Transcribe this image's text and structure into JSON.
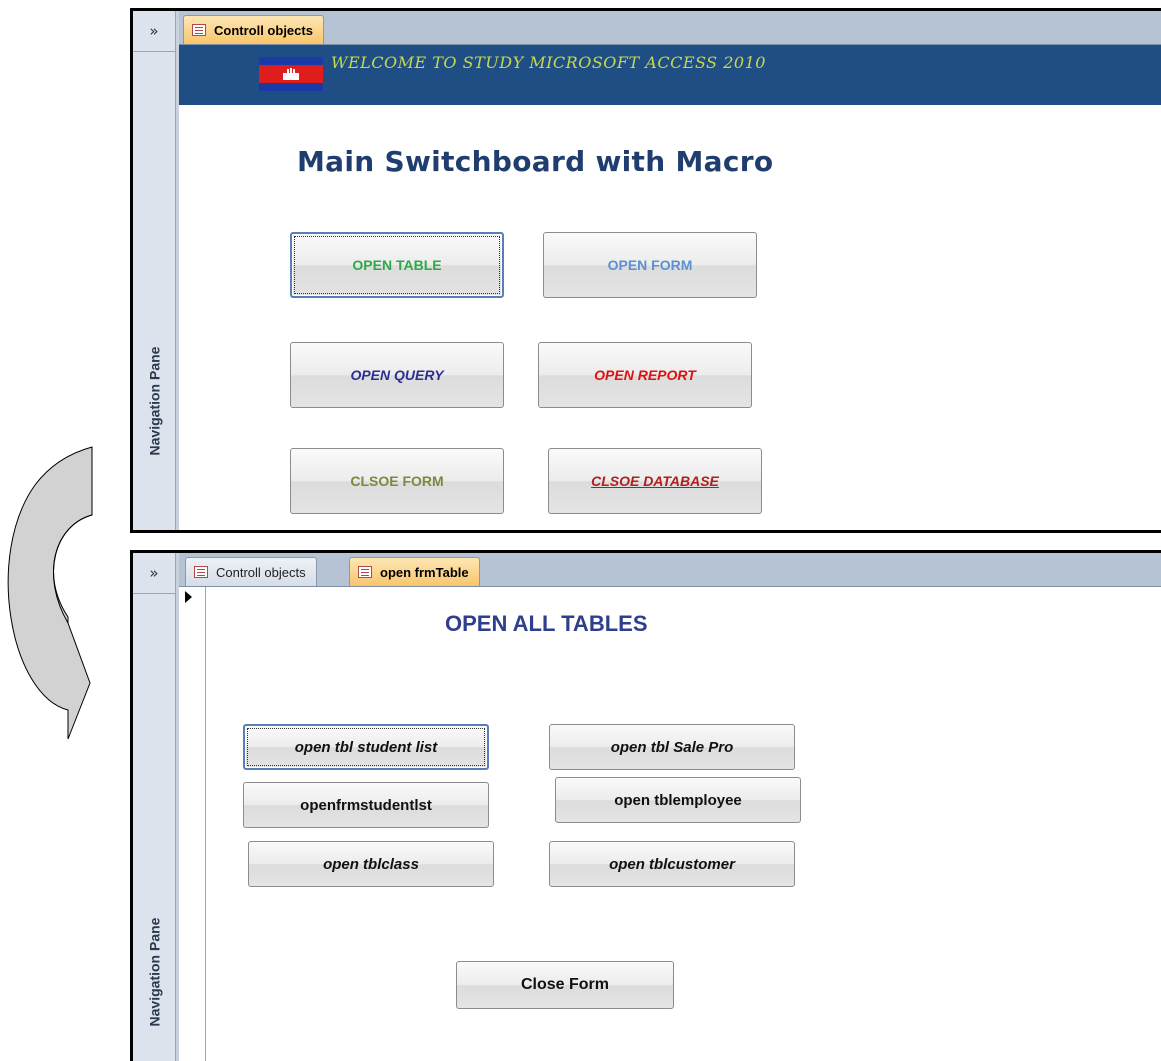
{
  "top": {
    "nav_chevron": "»",
    "nav_label": "Navigation Pane",
    "tab_label": "Controll objects",
    "welcome_text": "WELCOME TO STUDY MICROSOFT ACCESS 2010",
    "title": "Main Switchboard with Macro",
    "buttons": {
      "open_table": "OPEN TABLE",
      "open_form": "OPEN FORM",
      "open_query": "OPEN QUERY",
      "open_report": "OPEN REPORT",
      "close_form": "CLSOE FORM",
      "close_database": "CLSOE DATABASE"
    },
    "colors": {
      "header_band": "#1f4e85",
      "open_table": "#2ea84a",
      "open_form": "#5b8fd6",
      "open_query": "#2b2f8f",
      "open_report": "#e01010",
      "close_form": "#7a8a3e",
      "close_database": "#b01e1e"
    }
  },
  "bottom": {
    "nav_chevron": "»",
    "nav_label": "Navigation Pane",
    "tabs": [
      "Controll objects",
      "open frmTable"
    ],
    "title": "OPEN ALL TABLES",
    "buttons": {
      "student_list": "open tbl student list",
      "sale_pro": "open tbl Sale Pro",
      "frm_student": "openfrmstudentlst",
      "employee": "open tblemployee",
      "class": "open tblclass",
      "customer": "open tblcustomer",
      "close_form": "Close Form"
    }
  }
}
